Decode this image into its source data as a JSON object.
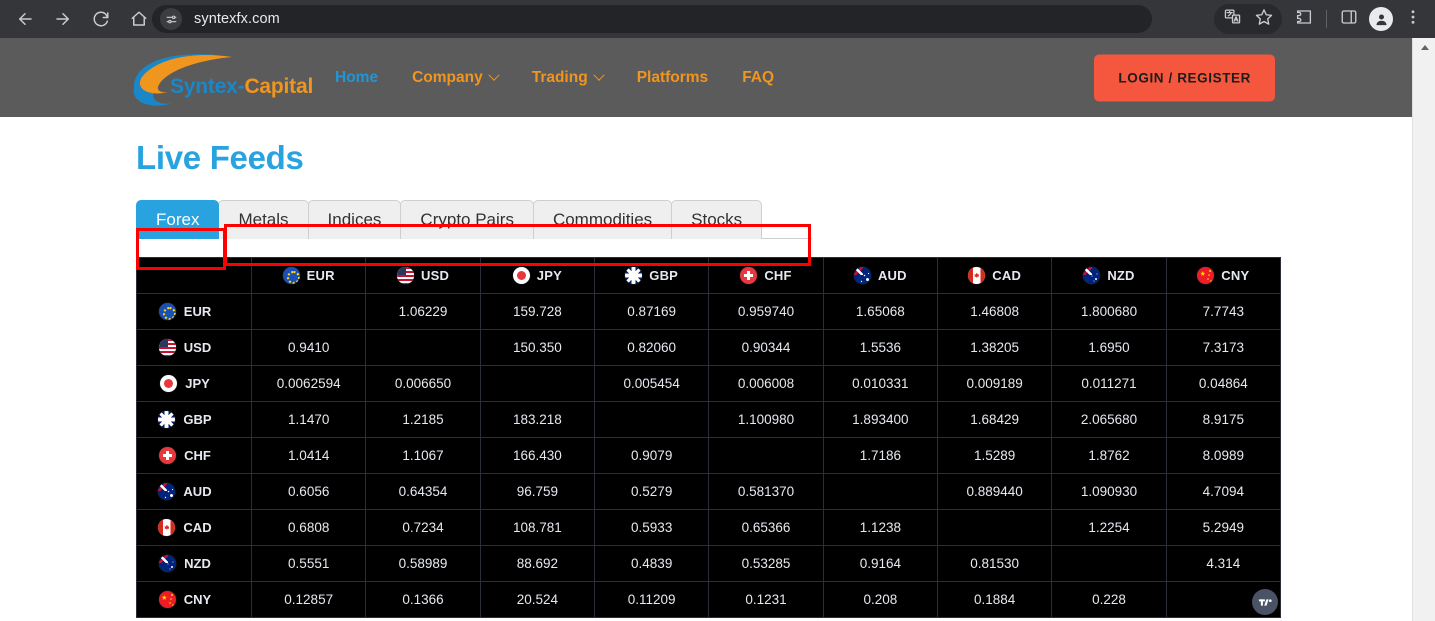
{
  "browser": {
    "back_icon": "back-arrow-icon",
    "forward_icon": "forward-arrow-icon",
    "reload_icon": "reload-icon",
    "home_icon": "home-icon",
    "site_info_icon": "site-settings-icon",
    "url": "syntexfx.com",
    "translate_icon": "translate-icon",
    "bookmark_icon": "star-icon",
    "extensions_icon": "extensions-puzzle-icon",
    "side_panel_icon": "side-panel-icon",
    "profile_icon": "profile-avatar-icon",
    "menu_icon": "three-dot-menu-icon"
  },
  "site_header": {
    "logo": {
      "part1": "Syntex-",
      "part2": "Capital"
    },
    "nav": [
      {
        "label": "Home",
        "active": true,
        "caret": false
      },
      {
        "label": "Company",
        "active": false,
        "caret": true
      },
      {
        "label": "Trading",
        "active": false,
        "caret": true
      },
      {
        "label": "Platforms",
        "active": false,
        "caret": false
      },
      {
        "label": "FAQ",
        "active": false,
        "caret": false
      }
    ],
    "login_label": "LOGIN / REGISTER",
    "accent_orange": "#f0951e",
    "accent_blue": "#2196d6",
    "cta_color": "#f4573d",
    "bg": "#5b5b5b"
  },
  "page": {
    "title": "Live Feeds",
    "title_color": "#29a3e0"
  },
  "tabs": {
    "items": [
      {
        "label": "Forex",
        "active": true
      },
      {
        "label": "Metals",
        "active": false
      },
      {
        "label": "Indices",
        "active": false
      },
      {
        "label": "Crypto Pairs",
        "active": false
      },
      {
        "label": "Commodities",
        "active": false
      },
      {
        "label": "Stocks",
        "active": false
      }
    ],
    "active_bg": "#29a3e0",
    "inactive_bg": "#efefef"
  },
  "annotations": {
    "color": "#fe0000",
    "boxes": [
      "forex-tab-highlight",
      "other-tabs-highlight"
    ]
  },
  "forex_table": {
    "attribution_icon": "tradingview-logo-icon",
    "colors": {
      "background": "#000000",
      "grid": "#2a2e39",
      "diagonal": "#1e222d",
      "up": "#1b3a2c",
      "down": "#8f2230"
    },
    "currencies": [
      "EUR",
      "USD",
      "JPY",
      "GBP",
      "CHF",
      "AUD",
      "CAD",
      "NZD",
      "CNY"
    ],
    "rows": [
      {
        "base": "EUR",
        "cells": [
          {
            "value": "",
            "state": "diag"
          },
          {
            "value": "1.06229",
            "state": "none"
          },
          {
            "value": "159.728",
            "state": "down"
          },
          {
            "value": "0.87169",
            "state": "none"
          },
          {
            "value": "0.959740",
            "state": "none"
          },
          {
            "value": "1.65068",
            "state": "none"
          },
          {
            "value": "1.46808",
            "state": "none"
          },
          {
            "value": "1.800680",
            "state": "none"
          },
          {
            "value": "7.7743",
            "state": "none"
          }
        ]
      },
      {
        "base": "USD",
        "cells": [
          {
            "value": "0.9410",
            "state": "none"
          },
          {
            "value": "",
            "state": "diag"
          },
          {
            "value": "150.350",
            "state": "none"
          },
          {
            "value": "0.82060",
            "state": "none"
          },
          {
            "value": "0.90344",
            "state": "up"
          },
          {
            "value": "1.5536",
            "state": "none"
          },
          {
            "value": "1.38205",
            "state": "none"
          },
          {
            "value": "1.6950",
            "state": "none"
          },
          {
            "value": "7.3173",
            "state": "none"
          }
        ]
      },
      {
        "base": "JPY",
        "cells": [
          {
            "value": "0.0062594",
            "state": "none"
          },
          {
            "value": "0.006650",
            "state": "none"
          },
          {
            "value": "",
            "state": "diag"
          },
          {
            "value": "0.005454",
            "state": "none"
          },
          {
            "value": "0.006008",
            "state": "none"
          },
          {
            "value": "0.010331",
            "state": "none"
          },
          {
            "value": "0.009189",
            "state": "none"
          },
          {
            "value": "0.011271",
            "state": "none"
          },
          {
            "value": "0.04864",
            "state": "none"
          }
        ]
      },
      {
        "base": "GBP",
        "cells": [
          {
            "value": "1.1470",
            "state": "none"
          },
          {
            "value": "1.2185",
            "state": "down"
          },
          {
            "value": "183.218",
            "state": "down"
          },
          {
            "value": "",
            "state": "diag"
          },
          {
            "value": "1.100980",
            "state": "none"
          },
          {
            "value": "1.893400",
            "state": "down"
          },
          {
            "value": "1.68429",
            "state": "none"
          },
          {
            "value": "2.065680",
            "state": "none"
          },
          {
            "value": "8.9175",
            "state": "none"
          }
        ]
      },
      {
        "base": "CHF",
        "cells": [
          {
            "value": "1.0414",
            "state": "none"
          },
          {
            "value": "1.1067",
            "state": "none"
          },
          {
            "value": "166.430",
            "state": "none"
          },
          {
            "value": "0.9079",
            "state": "none"
          },
          {
            "value": "",
            "state": "diag"
          },
          {
            "value": "1.7186",
            "state": "none"
          },
          {
            "value": "1.5289",
            "state": "none"
          },
          {
            "value": "1.8762",
            "state": "none"
          },
          {
            "value": "8.0989",
            "state": "none"
          }
        ]
      },
      {
        "base": "AUD",
        "cells": [
          {
            "value": "0.6056",
            "state": "none"
          },
          {
            "value": "0.64354",
            "state": "up"
          },
          {
            "value": "96.759",
            "state": "none"
          },
          {
            "value": "0.5279",
            "state": "none"
          },
          {
            "value": "0.581370",
            "state": "up"
          },
          {
            "value": "",
            "state": "diag"
          },
          {
            "value": "0.889440",
            "state": "none"
          },
          {
            "value": "1.090930",
            "state": "up"
          },
          {
            "value": "4.7094",
            "state": "none"
          }
        ]
      },
      {
        "base": "CAD",
        "cells": [
          {
            "value": "0.6808",
            "state": "none"
          },
          {
            "value": "0.7234",
            "state": "none"
          },
          {
            "value": "108.781",
            "state": "none"
          },
          {
            "value": "0.5933",
            "state": "none"
          },
          {
            "value": "0.65366",
            "state": "none"
          },
          {
            "value": "1.1238",
            "state": "none"
          },
          {
            "value": "",
            "state": "diag"
          },
          {
            "value": "1.2254",
            "state": "none"
          },
          {
            "value": "5.2949",
            "state": "none"
          }
        ]
      },
      {
        "base": "NZD",
        "cells": [
          {
            "value": "0.5551",
            "state": "none"
          },
          {
            "value": "0.58989",
            "state": "none"
          },
          {
            "value": "88.692",
            "state": "none"
          },
          {
            "value": "0.4839",
            "state": "none"
          },
          {
            "value": "0.53285",
            "state": "down"
          },
          {
            "value": "0.9164",
            "state": "none"
          },
          {
            "value": "0.81530",
            "state": "none"
          },
          {
            "value": "",
            "state": "diag"
          },
          {
            "value": "4.314",
            "state": "none"
          }
        ]
      },
      {
        "base": "CNY",
        "cells": [
          {
            "value": "0.12857",
            "state": "none"
          },
          {
            "value": "0.1366",
            "state": "none"
          },
          {
            "value": "20.524",
            "state": "none"
          },
          {
            "value": "0.11209",
            "state": "none"
          },
          {
            "value": "0.1231",
            "state": "none"
          },
          {
            "value": "0.208",
            "state": "none"
          },
          {
            "value": "0.1884",
            "state": "none"
          },
          {
            "value": "0.228",
            "state": "none"
          },
          {
            "value": "",
            "state": "diag"
          }
        ]
      }
    ]
  },
  "scrollbar": {
    "up_arrow_icon": "scroll-up-arrow-icon"
  }
}
